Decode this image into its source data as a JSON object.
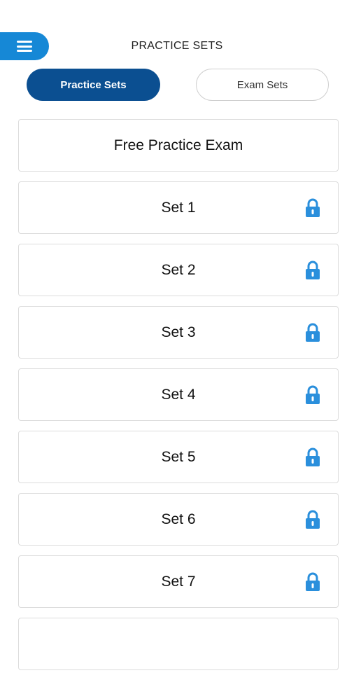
{
  "header": {
    "title": "PRACTICE SETS",
    "menu_icon": "hamburger-menu-icon"
  },
  "tabs": [
    {
      "label": "Practice Sets",
      "active": true
    },
    {
      "label": "Exam Sets",
      "active": false
    }
  ],
  "items": [
    {
      "label": "Free Practice Exam",
      "locked": false
    },
    {
      "label": "Set 1",
      "locked": true
    },
    {
      "label": "Set 2",
      "locked": true
    },
    {
      "label": "Set 3",
      "locked": true
    },
    {
      "label": "Set 4",
      "locked": true
    },
    {
      "label": "Set 5",
      "locked": true
    },
    {
      "label": "Set 6",
      "locked": true
    },
    {
      "label": "Set 7",
      "locked": true
    },
    {
      "label": "",
      "locked": false
    }
  ],
  "colors": {
    "accent": "#1688d6",
    "active_tab": "#0b4f91",
    "lock": "#2a8fdc"
  }
}
